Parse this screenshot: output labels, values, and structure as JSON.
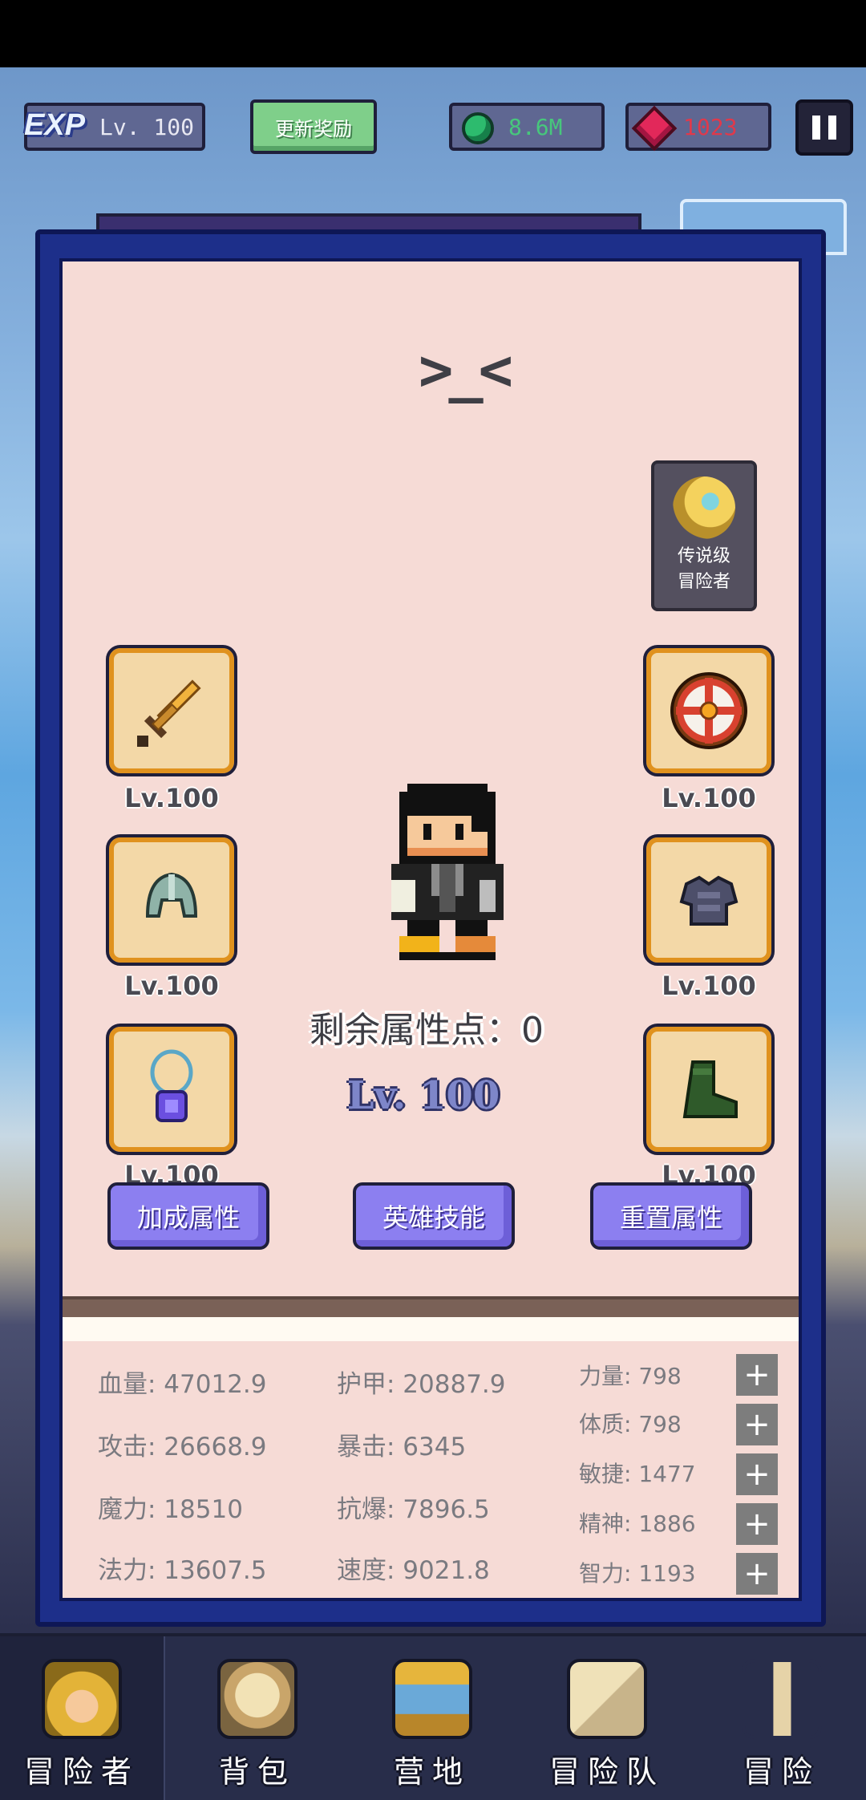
{
  "topbar": {
    "exp_badge": "EXP",
    "exp_level": "Lv. 100",
    "reward_button": "更新奖励",
    "gem_count": "8.6M",
    "ruby_count": "1023"
  },
  "hero": {
    "face": ">_<",
    "badge_line1": "传说级",
    "badge_line2": "冒险者",
    "remaining_points": "剩余属性点：0",
    "level": "Lv. 100"
  },
  "equipment": [
    {
      "slot": "weapon",
      "icon": "sword-icon",
      "level": "Lv.100"
    },
    {
      "slot": "shield",
      "icon": "shield-icon",
      "level": "Lv.100"
    },
    {
      "slot": "helmet",
      "icon": "helmet-icon",
      "level": "Lv.100"
    },
    {
      "slot": "armor",
      "icon": "armor-icon",
      "level": "Lv.100"
    },
    {
      "slot": "necklace",
      "icon": "necklace-icon",
      "level": "Lv.100"
    },
    {
      "slot": "boots",
      "icon": "boots-icon",
      "level": "Lv.100"
    }
  ],
  "actions": {
    "bonus": "加成属性",
    "skills": "英雄技能",
    "reset": "重置属性"
  },
  "stats": {
    "hp": "血量: 47012.9",
    "armor": "护甲: 20887.9",
    "attack": "攻击: 26668.9",
    "crit": "暴击: 6345",
    "magic": "魔力: 18510",
    "anti_crit": "抗爆: 7896.5",
    "mana": "法力: 13607.5",
    "speed": "速度: 9021.8"
  },
  "attributes": [
    {
      "label": "力量: 798"
    },
    {
      "label": "体质: 798"
    },
    {
      "label": "敏捷: 1477"
    },
    {
      "label": "精神: 1886"
    },
    {
      "label": "智力: 1193"
    }
  ],
  "plus_symbol": "+",
  "nav": [
    {
      "label": "冒险者",
      "icon": "crown-helmet-icon"
    },
    {
      "label": "背包",
      "icon": "backpack-icon"
    },
    {
      "label": "营地",
      "icon": "camp-banner-icon"
    },
    {
      "label": "冒险队",
      "icon": "book-icon"
    },
    {
      "label": "冒险",
      "icon": "sword-nav-icon"
    }
  ],
  "colors": {
    "panel": "#1d2f8a",
    "panel_inner": "#f6dbd6",
    "slot_border": "#e0921e",
    "button_purple": "#8c7ff0",
    "gem_green": "#47c77c",
    "ruby_red": "#e0394b"
  }
}
